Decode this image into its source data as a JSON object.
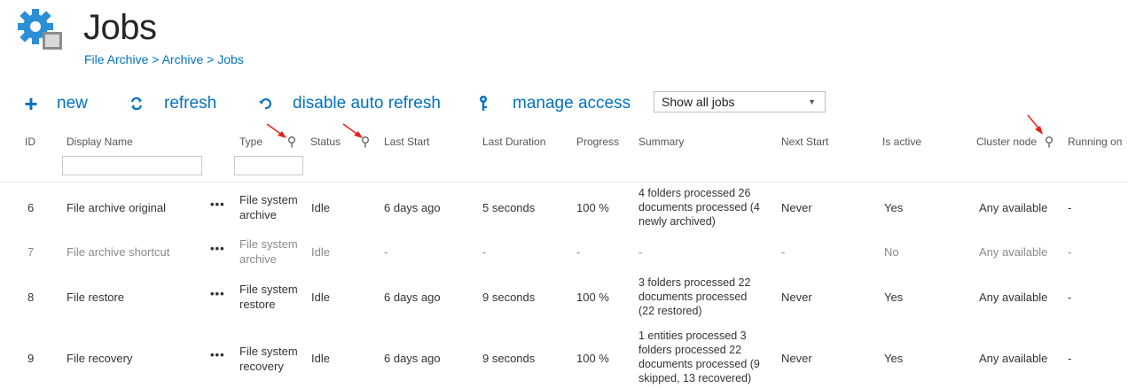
{
  "page": {
    "title": "Jobs",
    "breadcrumb": [
      "File Archive",
      "Archive",
      "Jobs"
    ],
    "breadcrumb_sep": ">"
  },
  "toolbar": {
    "new_label": "new",
    "refresh_label": "refresh",
    "disable_auto_refresh_label": "disable auto refresh",
    "manage_access_label": "manage access",
    "filter_select_value": "Show all jobs"
  },
  "columns": {
    "id": "ID",
    "display_name": "Display Name",
    "type": "Type",
    "status": "Status",
    "last_start": "Last Start",
    "last_duration": "Last Duration",
    "progress": "Progress",
    "summary": "Summary",
    "next_start": "Next Start",
    "is_active": "Is active",
    "cluster_node": "Cluster node",
    "running_on": "Running on"
  },
  "rows": [
    {
      "id": "6",
      "name": "File archive original",
      "menu": "•••",
      "type": [
        "File system",
        "archive"
      ],
      "status": "Idle",
      "last_start": "6 days ago",
      "last_duration": "5 seconds",
      "progress": "100 %",
      "summary": [
        "4 folders processed 26",
        "documents processed (4",
        "newly archived)"
      ],
      "next_start": "Never",
      "is_active": "Yes",
      "cluster_node": "Any available",
      "running_on": "-"
    },
    {
      "id": "7",
      "name": "File archive shortcut",
      "menu": "•••",
      "type": [
        "File system",
        "archive"
      ],
      "status": "Idle",
      "last_start": "-",
      "last_duration": "-",
      "progress": "-",
      "summary": [
        "-"
      ],
      "next_start": "-",
      "is_active": "No",
      "cluster_node": "Any available",
      "running_on": "-"
    },
    {
      "id": "8",
      "name": "File restore",
      "menu": "•••",
      "type": [
        "File system",
        "restore"
      ],
      "status": "Idle",
      "last_start": "6 days ago",
      "last_duration": "9 seconds",
      "progress": "100 %",
      "summary": [
        "3 folders processed 22",
        "documents processed",
        "(22 restored)"
      ],
      "next_start": "Never",
      "is_active": "Yes",
      "cluster_node": "Any available",
      "running_on": "-"
    },
    {
      "id": "9",
      "name": "File recovery",
      "menu": "•••",
      "type": [
        "File system",
        "recovery"
      ],
      "status": "Idle",
      "last_start": "6 days ago",
      "last_duration": "9 seconds",
      "progress": "100 %",
      "summary": [
        "1 entities processed 3",
        "folders processed 22",
        "documents processed (9",
        "skipped, 13 recovered)"
      ],
      "next_start": "Never",
      "is_active": "Yes",
      "cluster_node": "Any available",
      "running_on": "-"
    }
  ],
  "colors": {
    "accent": "#0072c6",
    "arrow": "#e8221b",
    "dim_text": "#8a8a8a"
  },
  "icons": [
    "jobs-gear-icon",
    "plus-icon",
    "refresh-icon",
    "disable-refresh-icon",
    "key-icon",
    "dropdown-arrow-icon",
    "filter-icon",
    "ellipsis-icon"
  ]
}
